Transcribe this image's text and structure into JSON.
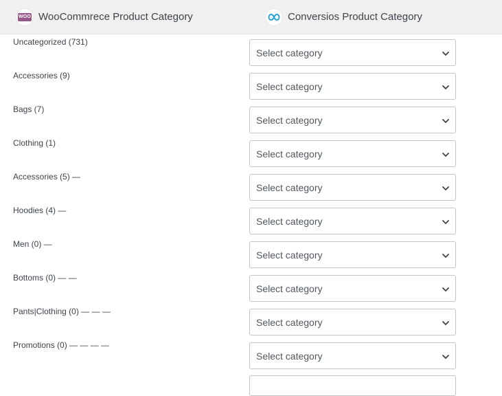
{
  "header": {
    "woo_logo_text": "WOO",
    "woo_title": "WooCommrece Product Category",
    "conv_title": "Conversios Product Category"
  },
  "select_placeholder": "Select category",
  "rows": [
    {
      "label": "Uncategorized (731)",
      "select_value": "Select category"
    },
    {
      "label": "Accessories (9)",
      "select_value": "Select category"
    },
    {
      "label": "Bags (7)",
      "select_value": "Select category"
    },
    {
      "label": "Clothing (1)",
      "select_value": "Select category"
    },
    {
      "label": "Accessories (5) —",
      "select_value": "Select category"
    },
    {
      "label": "Hoodies (4) —",
      "select_value": "Select category"
    },
    {
      "label": "Men (0) —",
      "select_value": "Select category"
    },
    {
      "label": "Bottoms (0) — —",
      "select_value": "Select category"
    },
    {
      "label": "Pants|Clothing (0) — — —",
      "select_value": "Select category"
    },
    {
      "label": "Promotions (0) — — — —",
      "select_value": "Select category"
    }
  ],
  "colors": {
    "woo_purple": "#96588a",
    "conversios_blue": "#2ba3d6",
    "header_bg": "#f0f0f1"
  }
}
